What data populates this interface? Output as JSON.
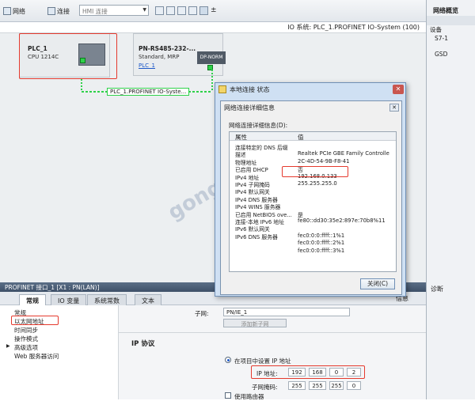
{
  "toolbar": {
    "network_label": "网络",
    "connect_label": "连接",
    "hmi_combo": "HMI 连接"
  },
  "subheader": {
    "io_system": "IO 系统: PLC_1.PROFINET IO-System (100)"
  },
  "right_panel": {
    "title": "网络概览",
    "items": [
      "设备",
      "S7-1",
      "GSD"
    ]
  },
  "devices": {
    "plc": {
      "name": "PLC_1",
      "type": "CPU 1214C"
    },
    "pn": {
      "name": "PN-RS485-232-...",
      "sub": "Standard, MRP",
      "link": "PLC_1",
      "badge": "DP-NORM"
    },
    "network_label": "PLC_1.PROFINET IO-Syste..."
  },
  "dialog": {
    "title": "本地连接 状态",
    "inner_title": "网络连接详细信息",
    "table_label": "网络连接详细信息(D):",
    "col_property": "属性",
    "col_value": "值",
    "rows": [
      {
        "k": "连接特定的 DNS 后缀",
        "v": ""
      },
      {
        "k": "描述",
        "v": "Realtek PCIe GBE Family Controlle"
      },
      {
        "k": "物理地址",
        "v": "2C-4D-54-9B-F8-41"
      },
      {
        "k": "已启用 DHCP",
        "v": "否"
      },
      {
        "k": "IPv4 地址",
        "v": "192.168.0.133"
      },
      {
        "k": "IPv4 子网掩码",
        "v": "255.255.255.0"
      },
      {
        "k": "IPv4 默认网关",
        "v": ""
      },
      {
        "k": "IPv4 DNS 服务器",
        "v": ""
      },
      {
        "k": "IPv4 WINS 服务器",
        "v": ""
      },
      {
        "k": "已启用 NetBIOS ove...",
        "v": "是"
      },
      {
        "k": "连接-本地 IPv6 地址",
        "v": "fe80::dd30:35e2:897e:70b8%11"
      },
      {
        "k": "IPv6 默认网关",
        "v": ""
      },
      {
        "k": "IPv6 DNS 服务器",
        "v": "fec0:0:0:ffff::1%1"
      },
      {
        "k": "",
        "v": "fec0:0:0:ffff::2%1"
      },
      {
        "k": "",
        "v": "fec0:0:0:ffff::3%1"
      }
    ],
    "close_label": "关闭(C)"
  },
  "lower": {
    "header": "PROFINET 接口_1 [X1 : PN(LAN)]",
    "tabs": [
      "常规",
      "IO 变量",
      "系统常数",
      "文本"
    ],
    "right_tabs": [
      "信息",
      "诊断"
    ],
    "nav": [
      "常规",
      "以太网地址",
      "时间同步",
      "操作模式",
      "高级选项",
      "Web 服务器访问"
    ],
    "subnet_label": "子网:",
    "subnet_value": "PN/IE_1",
    "add_subnet": "添加新子网",
    "ip_section": "IP 协议",
    "radio_label": "在项目中设置 IP 地址",
    "ip_label": "IP 地址:",
    "ip": [
      "192",
      "168",
      "0",
      "2"
    ],
    "mask_label": "子网掩码:",
    "mask": [
      "255",
      "255",
      "255",
      "0"
    ],
    "router_label": "使用路由器"
  },
  "watermark": "gongkong"
}
